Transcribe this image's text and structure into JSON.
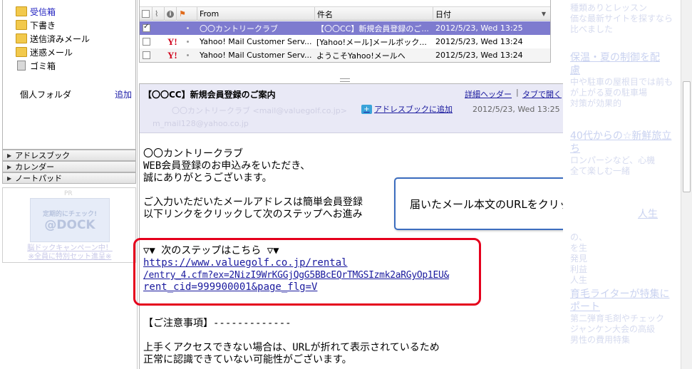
{
  "folders": [
    {
      "label": "受信箱",
      "icon": "inbox-folder-icon",
      "selected": true
    },
    {
      "label": "下書き",
      "icon": "draft-folder-icon"
    },
    {
      "label": "送信済みメール",
      "icon": "sent-folder-icon"
    },
    {
      "label": "迷惑メール",
      "icon": "spam-folder-icon"
    },
    {
      "label": "ゴミ箱",
      "icon": "trash-icon"
    }
  ],
  "personal_folder": {
    "label": "個人フォルダ",
    "add_label": "追加"
  },
  "sections": [
    "アドレスブック",
    "カレンダー",
    "ノートパッド"
  ],
  "ad": {
    "pr": "PR",
    "banner_line1": "定期的にチェック!",
    "banner_line2": "@DOCK",
    "link_line1": "脳ドックキャンペーン中！",
    "link_line2": "※全員に特別セット進呈※"
  },
  "mail_list": {
    "columns": {
      "from": "From",
      "subject": "件名",
      "date": "日付"
    },
    "rows": [
      {
        "from": "〇〇カントリークラブ",
        "subject": "【〇〇CC】新規会員登録のご...",
        "date": "2012/5/23, Wed 13:25",
        "checked": true,
        "yahoo": false
      },
      {
        "from": "Yahoo! Mail Customer Serv...",
        "subject": "[Yahoo!メール]メールボック...",
        "date": "2012/5/23, Wed 13:24",
        "checked": false,
        "yahoo": true
      },
      {
        "from": "Yahoo! Mail Customer Serv...",
        "subject": "ようこそYahoo!メールへ",
        "date": "2012/5/23, Wed 13:24",
        "checked": false,
        "yahoo": true
      }
    ]
  },
  "message": {
    "subject": "【〇〇CC】新規会員登録のご案内",
    "detail_header_label": "詳細ヘッダー",
    "separator": "|",
    "open_tab_label": "タブで開く",
    "from_line": "〇〇カントリークラブ <mail@valuegolf.co.jp>",
    "to_line": "m_mail128@yahoo.co.jp",
    "add_address_label": "アドレスブックに追加",
    "date": "2012/5/23, Wed 13:25",
    "body": {
      "l1": "〇〇カントリークラブ",
      "l2": "WEB会員登録のお申込みをいただき、",
      "l3": "誠にありがとうございます。",
      "l4": "ご入力いただいたメールアドレスは簡単会員登録",
      "l5": "以下リンクをクリックして次のステップへお進み",
      "l6": "▽▼ 次のステップはこちら ▽▼",
      "url1": "https://www.valuegolf.co.jp/rental",
      "url2": "/entry_4.cfm?ex=2NizI9WrKGGjQgG5BBcEQrTMGSIzmk2aRGyOp1EU&",
      "url3": "rent_cid=999900001&page_flg=V",
      "l7": "【ご注意事項】-------------",
      "l8": "上手くアクセスできない場合は、URLが折れて表示されているため",
      "l9": "正常に認識できていない可能性がございます。"
    }
  },
  "callout": {
    "text": "届いたメール本文のURLをクリック"
  },
  "right_pane": {
    "t1": "種類ありとレッスン",
    "t2": "価な最新サイトを探すなら",
    "t3": "比べました",
    "h1": "保温・夏の制御を配",
    "h1b": "慮",
    "t4": "中や駐車の屋根目では前も",
    "t5": "が上がる夏の駐車場",
    "t6": "対策が効果的",
    "h2": "40代からの☆新鮮旅立",
    "h2b": "ち",
    "t7": "ロンパーシなど、心機",
    "t8": "全て楽しむ一緒",
    "h3": "人生",
    "t9": "の、",
    "t10": "を生",
    "t11": "発見",
    "t12": "利益",
    "t13": "人生",
    "h4": "育毛ライターが特集に",
    "h4b": "ポート",
    "t14": "第二弾育毛剤やチェック",
    "t15": "ジャンケン大会の高級",
    "t16": "男性の費用特集"
  }
}
